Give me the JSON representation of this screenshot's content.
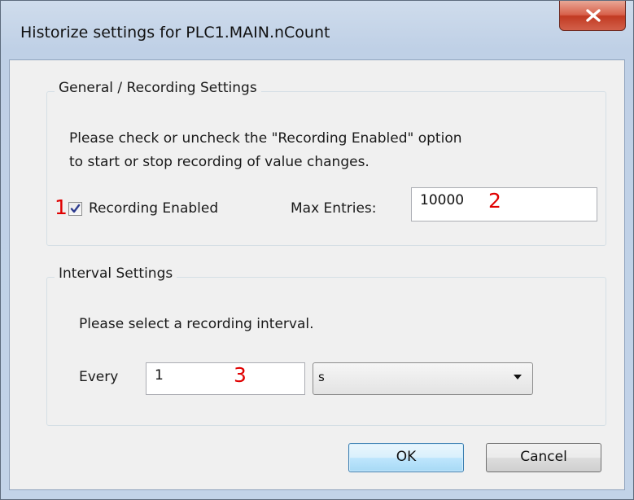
{
  "window": {
    "title": "Historize settings for PLC1.MAIN.nCount",
    "close_icon": "close-x-icon"
  },
  "general": {
    "legend": "General / Recording Settings",
    "description_line1": "Please check or uncheck the \"Recording Enabled\" option",
    "description_line2": "to start or stop recording of value changes.",
    "recording_enabled_label": "Recording Enabled",
    "recording_enabled_checked": true,
    "max_entries_label": "Max Entries:",
    "max_entries_value": "10000"
  },
  "interval": {
    "legend": "Interval Settings",
    "description": "Please select a recording interval.",
    "every_label": "Every",
    "every_value": "1",
    "unit_selected": "s"
  },
  "buttons": {
    "ok_label": "OK",
    "cancel_label": "Cancel"
  },
  "annotations": {
    "marker1": "1",
    "marker2": "2",
    "marker3": "3",
    "color": "#e00000"
  }
}
